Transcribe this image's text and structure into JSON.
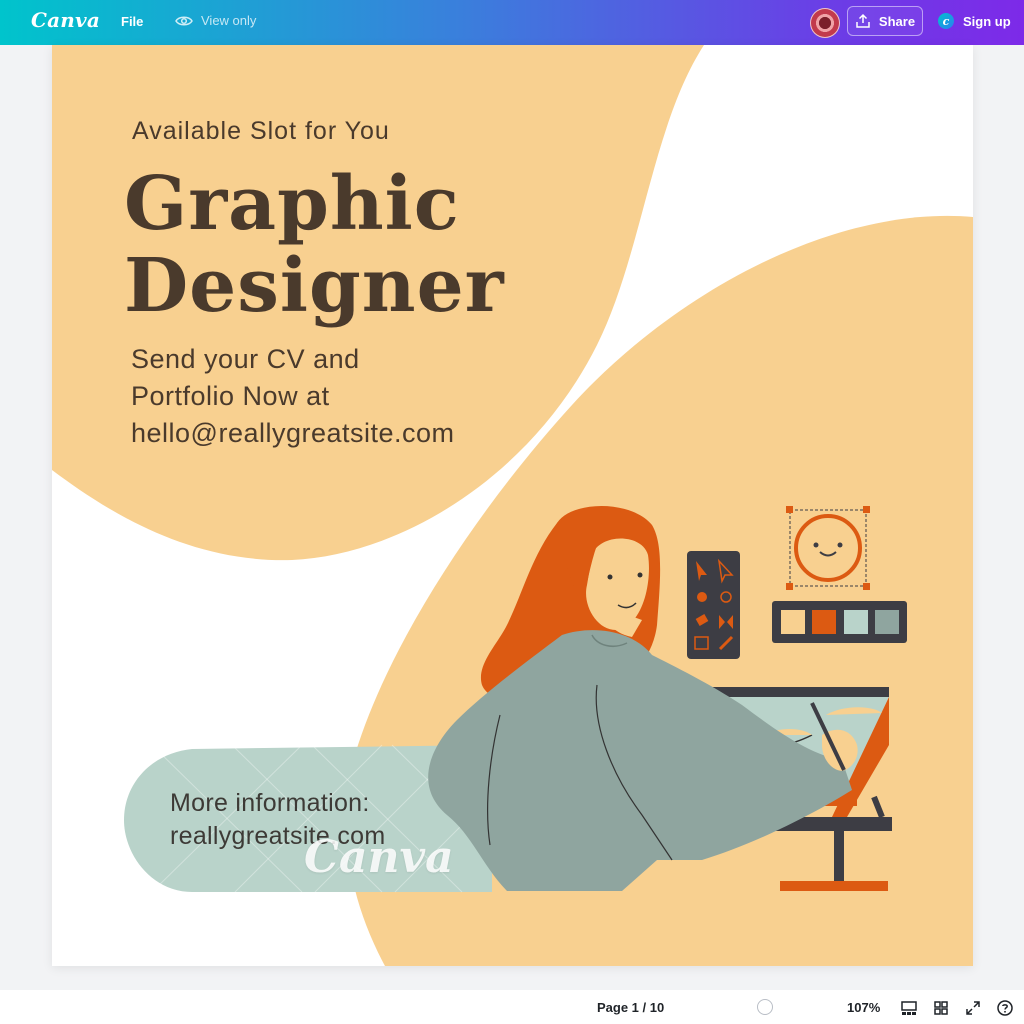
{
  "topbar": {
    "logo": "Canva",
    "file_label": "File",
    "view_only_label": "View only",
    "share_label": "Share",
    "signup_label": "Sign up"
  },
  "design": {
    "subtitle": "Available Slot for You",
    "title_lines": [
      "Graphic",
      "Designer"
    ],
    "cta_lines": [
      "Send your CV and",
      "Portfolio Now at",
      "hello@reallygreatsite.com"
    ],
    "more_info_lines": [
      "More information:",
      "reallygreatsite.com"
    ],
    "watermark": "Canva"
  },
  "bottombar": {
    "page_indicator": "Page 1 / 10",
    "zoom_level": "107%"
  },
  "colors": {
    "peach": "#f8d090",
    "sage": "#b9d3ca",
    "orange": "#dc5a12",
    "dark_brown": "#4a3a2c",
    "sweater": "#8fa59f"
  }
}
